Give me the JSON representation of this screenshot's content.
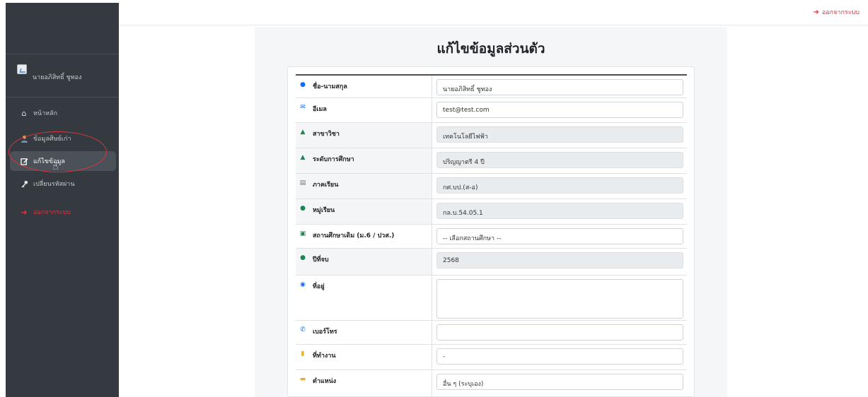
{
  "user": {
    "name": "นายอภิสิทธิ์ ชูทอง"
  },
  "nav": {
    "items": [
      {
        "label": "หน้าหลัก",
        "icon": "home-icon"
      },
      {
        "label": "ข้อมูลศิษย์เก่า",
        "icon": "user-icon"
      },
      {
        "label": "แก้ไขข้อมูล",
        "icon": "edit-icon"
      },
      {
        "label": "เปลี่ยนรหัสผ่าน",
        "icon": "key-icon"
      }
    ],
    "logout_label": "ออกจากระบบ"
  },
  "topbar": {
    "logout_label": "ออกจากระบบ"
  },
  "page": {
    "title": "แก้ไขข้อมูลส่วนตัว"
  },
  "form": {
    "rows": [
      {
        "label": "ชื่อ-นามสกุล",
        "value": "นายอภิสิทธิ์ ชูทอง",
        "readonly": false,
        "icon": "user-icon"
      },
      {
        "label": "อีเมล",
        "value": "test@test.com",
        "readonly": false,
        "icon": "envelope-icon"
      },
      {
        "label": "สาขาวิชา",
        "value": "เทคโนโลยีไฟฟ้า",
        "readonly": true,
        "icon": "graduation-cap-icon"
      },
      {
        "label": "ระดับการศึกษา",
        "value": "ปริญญาตรี 4 ปี",
        "readonly": true,
        "icon": "graduation-cap-icon"
      },
      {
        "label": "ภาคเรียน",
        "value": "กศ.บป.(ส-อ)",
        "readonly": true,
        "icon": "calendar-icon"
      },
      {
        "label": "หมู่เรียน",
        "value": "กล.บ.54.05.1",
        "readonly": true,
        "icon": "users-icon"
      },
      {
        "label": "สถานศึกษาเดิม (ม.6 / ปวส.)",
        "value": "-- เลือกสถานศึกษา --",
        "readonly": false,
        "icon": "school-icon"
      },
      {
        "label": "ปีที่จบ",
        "value": "2568",
        "readonly": true,
        "icon": "award-icon"
      },
      {
        "label": "ที่อยู่",
        "value": "",
        "readonly": false,
        "icon": "map-marker-icon"
      },
      {
        "label": "เบอร์โทร",
        "value": "",
        "readonly": false,
        "icon": "phone-icon"
      },
      {
        "label": "ที่ทำงาน",
        "value": "-",
        "readonly": false,
        "icon": "building-icon"
      },
      {
        "label": "ตำแหน่ง",
        "value": "อื่น ๆ (ระบุเอง)",
        "readonly": false,
        "icon": "id-card-icon"
      }
    ]
  },
  "colors": {
    "sidebar": "#343a40",
    "logout": "#dc3545",
    "accent": "#0d6efd"
  }
}
